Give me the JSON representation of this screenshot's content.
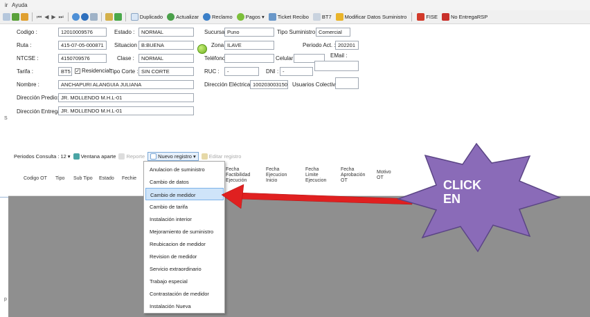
{
  "menubar": {
    "item1": "ir",
    "item2": "Ayuda"
  },
  "toolbar": {
    "buttons": [
      {
        "label": "Duplicado"
      },
      {
        "label": "Actualizar"
      },
      {
        "label": "Reclamo"
      },
      {
        "label": "Pagos ▾"
      },
      {
        "label": "Ticket Recibo"
      },
      {
        "label": "BT7"
      },
      {
        "label": "Modificar Datos Suministro"
      },
      {
        "label": "FISE"
      },
      {
        "label": "No EntregaRSP"
      }
    ]
  },
  "form": {
    "codigo_label": "Codigo :",
    "codigo_value": "12010009576",
    "estado_label": "Estado :",
    "estado_value": "NORMAL",
    "ruta_label": "Ruta :",
    "ruta_value": "415-07-05-000871",
    "situacion_label": "Situacion :",
    "situacion_value": "B:BUENA",
    "ntcse_label": "NTCSE :",
    "ntcse_value": "4150709576",
    "clase_label": "Clase :",
    "clase_value": "NORMAL",
    "tarifa_label": "Tarifa :",
    "tarifa_value": "BT5",
    "residencial_label": "Residencial",
    "tipo_corte_label": "Tipo Corte :",
    "tipo_corte_value": "SIN CORTE",
    "nombre_label": "Nombre :",
    "nombre_value": "ANCHAPURI ALANGUIA JULIANA",
    "direccion_predio_label": "Dirección Predio:",
    "direccion_predio_value": "JR. MOLLENDO M.H.L-01",
    "direccion_entrega_label": "Dirección Entrega:",
    "direccion_entrega_value": "JR. MOLLENDO M.H.L-01",
    "sucursal_label": "Sucursal",
    "sucursal_value": "Puno",
    "tipo_suministro_label": "Tipo Suministro",
    "tipo_suministro_value": "Comercial",
    "zona_label": "Zona :",
    "zona_value": "ILAVE",
    "periodo_label": "Periodo Act. :",
    "periodo_value": "202201",
    "telefono_label": "Teléfono:",
    "telefono_value": "",
    "celular_label": "Celular :",
    "celular_value": "",
    "email_label": "EMail :",
    "email_value": "",
    "ruc_label": "RUC :",
    "ruc_value": "-",
    "dni_label": "DNI :",
    "dni_value": "-",
    "direccion_electrica_label": "Dirección Eléctrica :",
    "direccion_electrica_value": "1002030031501",
    "usuarios_colectivos_label": "Usuarios Colectivos",
    "usuarios_colectivos_value": ""
  },
  "table_toolbar": {
    "periodos_label": "Periodos Consulta :",
    "periodos_value": "12",
    "ventana_label": "Ventana aparte",
    "reporte_label": "Reporte",
    "nuevo_label": "Nuevo registro ▾",
    "editar_label": "Editar registro"
  },
  "columns": {
    "c1": "Codigo OT",
    "c2": "Tipo",
    "c3": "Sub Tipo",
    "c4": "Estado",
    "c5": "Fechie",
    "c6": "Fecha\nFactibilidad\nEjecución",
    "c7": "Fecha\nEjecucion\nInicio",
    "c8": "Fecha\nLimite\nEjecucion",
    "c9": "Fecha\nAprobación\nOT",
    "c10": "Motivo\nOT"
  },
  "menu": {
    "items": [
      "Anulacion de suministro",
      "Cambio de datos",
      "Cambio de medidor",
      "Cambio de tarifa",
      "Instalación interior",
      "Mejoramiento de suministro",
      "Reubicacion de medidor",
      "Revision de medidor",
      "Servicio extraordinario",
      "Trabajo especial",
      "Contrastación de medidor",
      "Instalación Nueva"
    ],
    "highlighted_index": 2
  },
  "annotation": {
    "line1": "CLICK",
    "line2": "EN",
    "star_color": "#8a6bb8",
    "arrow_color": "#e02020"
  },
  "left_marks": {
    "mark1": "S",
    "mark2": "p"
  }
}
